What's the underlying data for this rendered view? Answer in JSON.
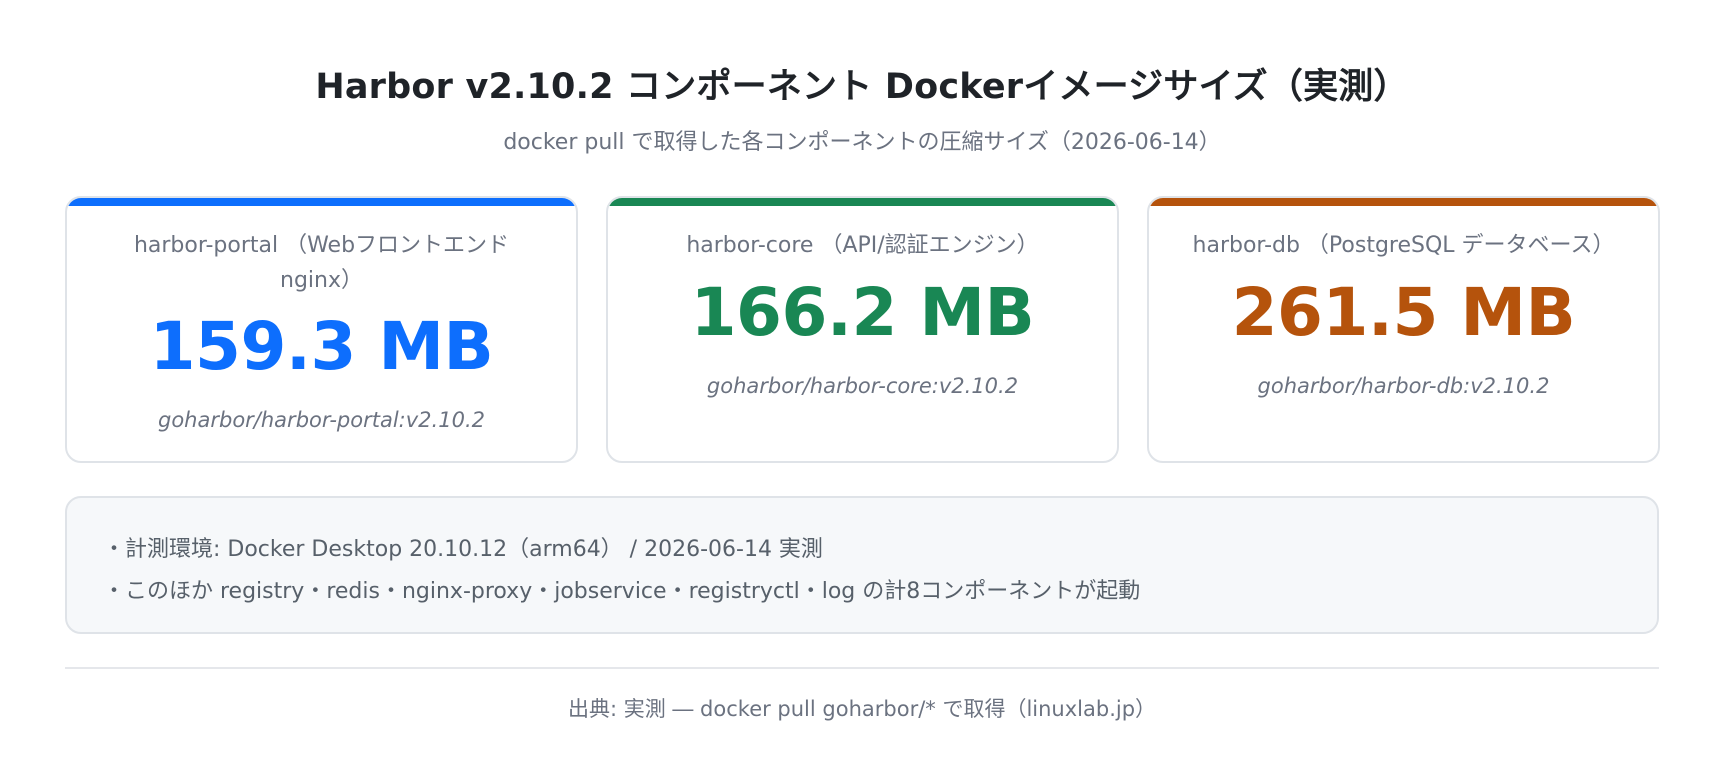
{
  "header": {
    "title": "Harbor v2.10.2 コンポーネント Dockerイメージサイズ（実測）",
    "subtitle": "docker pull で取得した各コンポーネントの圧縮サイズ（2026-06-14）"
  },
  "cards": [
    {
      "name": "harbor-portal （Webフロントエンド nginx）",
      "value": "159.3 MB",
      "image": "goharbor/harbor-portal:v2.10.2",
      "color": "#0d6efd"
    },
    {
      "name": "harbor-core （API/認証エンジン）",
      "value": "166.2 MB",
      "image": "goharbor/harbor-core:v2.10.2",
      "color": "#198754"
    },
    {
      "name": "harbor-db （PostgreSQL データベース）",
      "value": "261.5 MB",
      "image": "goharbor/harbor-db:v2.10.2",
      "color": "#b5530c"
    }
  ],
  "notes": [
    "・計測環境: Docker Desktop 20.10.12（arm64） / 2026-06-14 実測",
    "・このほか registry・redis・nginx-proxy・jobservice・registryctl・log の計8コンポーネントが起動"
  ],
  "footer": {
    "source": "出典: 実測 ― docker pull goharbor/* で取得（linuxlab.jp）"
  }
}
